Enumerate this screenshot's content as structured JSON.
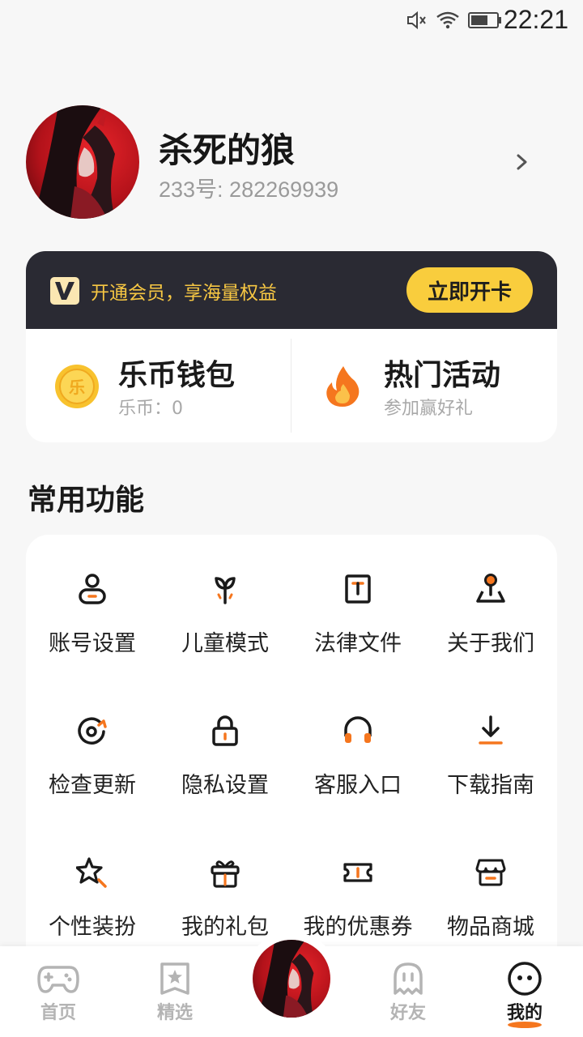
{
  "status_bar": {
    "time": "22:21",
    "icons": [
      "mute-icon",
      "wifi-icon",
      "battery-icon"
    ]
  },
  "profile": {
    "name": "杀死的狼",
    "uid": "233号: 282269939"
  },
  "vip": {
    "text": "开通会员，享海量权益",
    "button": "立即开卡",
    "accent": "#f9cd3d",
    "banner_bg": "#2a2a33"
  },
  "wallet": {
    "coins": {
      "title": "乐币钱包",
      "sub": "乐币：0",
      "icon": "coin-icon"
    },
    "activity": {
      "title": "热门活动",
      "sub": "参加赢好礼",
      "icon": "fire-icon"
    }
  },
  "section": {
    "title": "常用功能"
  },
  "functions": [
    {
      "label": "账号设置",
      "icon": "user-icon"
    },
    {
      "label": "儿童模式",
      "icon": "sprout-icon"
    },
    {
      "label": "法律文件",
      "icon": "document-icon"
    },
    {
      "label": "关于我们",
      "icon": "joystick-icon"
    },
    {
      "label": "检查更新",
      "icon": "refresh-icon"
    },
    {
      "label": "隐私设置",
      "icon": "lock-icon"
    },
    {
      "label": "客服入口",
      "icon": "headphones-icon"
    },
    {
      "label": "下载指南",
      "icon": "download-icon"
    },
    {
      "label": "个性装扮",
      "icon": "star-brush-icon"
    },
    {
      "label": "我的礼包",
      "icon": "gift-icon"
    },
    {
      "label": "我的优惠券",
      "icon": "ticket-icon"
    },
    {
      "label": "物品商城",
      "icon": "store-icon"
    }
  ],
  "nav": [
    {
      "label": "首页",
      "icon": "gamepad-icon",
      "active": false
    },
    {
      "label": "精选",
      "icon": "star-bookmark-icon",
      "active": false
    },
    {
      "label": "",
      "icon": "avatar",
      "active": false
    },
    {
      "label": "好友",
      "icon": "ghost-icon",
      "active": false
    },
    {
      "label": "我的",
      "icon": "face-icon",
      "active": true
    }
  ],
  "colors": {
    "orange": "#f5761e",
    "dark": "#1a1a1a"
  }
}
